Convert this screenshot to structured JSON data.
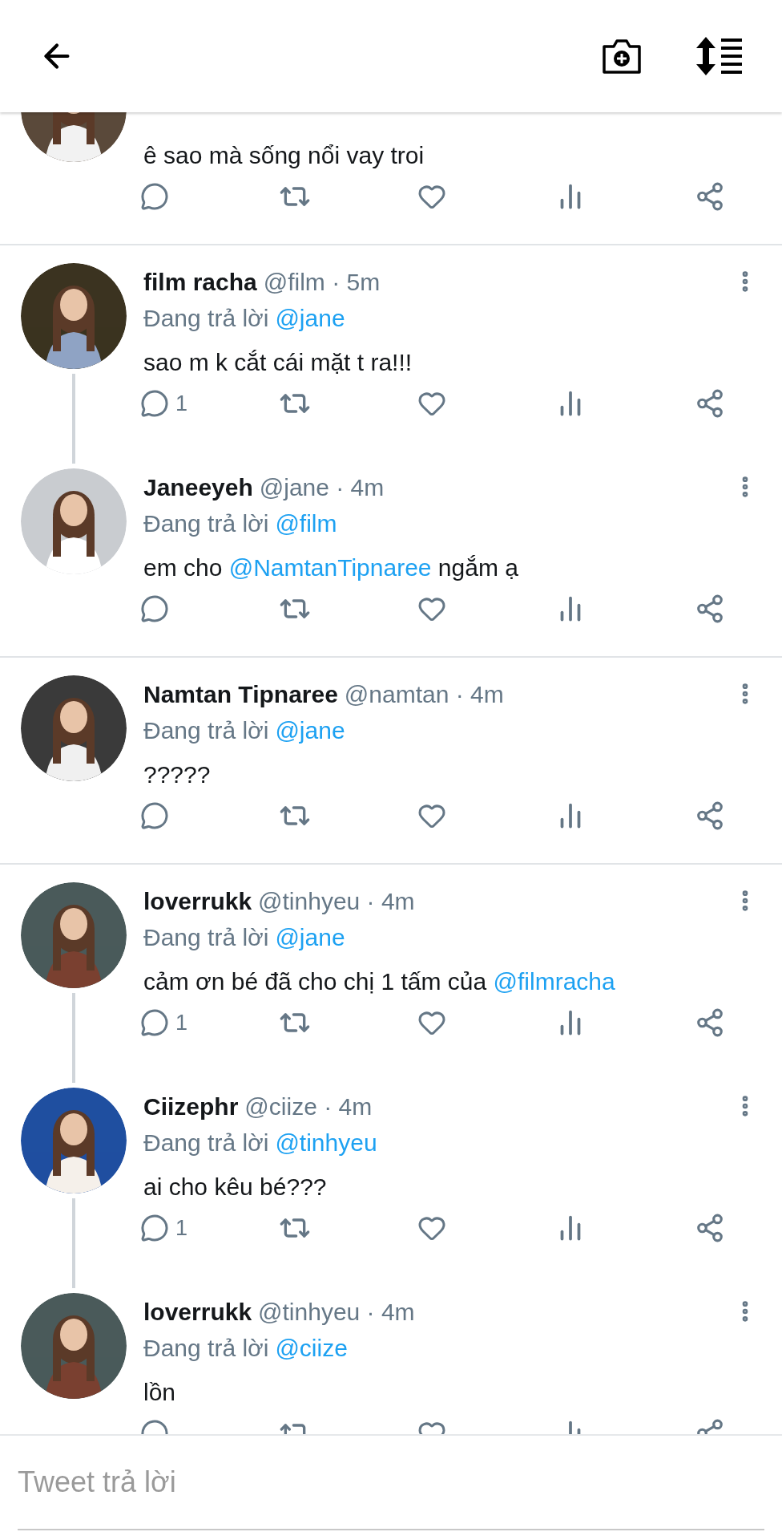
{
  "threads": [
    {
      "tweets": [
        {
          "text": [
            {
              "kind": "plain",
              "text": "ê sao mà sống nổi vay troi"
            }
          ],
          "avatar": {
            "kind": "picture"
          }
        }
      ]
    },
    {
      "tweets": [
        {
          "name": "film racha",
          "meta": "@film · 5m",
          "reply_label": "Đang trả lời",
          "reply_to": "@jane",
          "text": [
            {
              "kind": "plain",
              "text": "sao m k cắt cái mặt t ra!!!"
            }
          ],
          "reply_count": "1",
          "avatar": {
            "kind": "picture"
          }
        },
        {
          "name": "Janeeyeh",
          "meta": "@jane · 4m",
          "reply_label": "Đang trả lời",
          "reply_to": "@film",
          "text": [
            {
              "kind": "plain",
              "text": "em cho "
            },
            {
              "kind": "mention",
              "text": "@NamtanTipnaree"
            },
            {
              "kind": "plain",
              "text": " ngắm ạ"
            }
          ],
          "avatar": {
            "kind": "picture"
          }
        }
      ]
    },
    {
      "tweets": [
        {
          "name": "Namtan Tipnaree",
          "meta": "@namtan · 4m",
          "reply_label": "Đang trả lời",
          "reply_to": "@jane",
          "text": [
            {
              "kind": "plain",
              "text": "?????"
            }
          ],
          "avatar": {
            "kind": "picture"
          }
        }
      ]
    },
    {
      "tweets": [
        {
          "name": "loverrukk",
          "meta": "@tinhyeu · 4m",
          "reply_label": "Đang trả lời",
          "reply_to": "@jane",
          "text": [
            {
              "kind": "plain",
              "text": "cảm ơn bé đã cho chị 1 tấm của "
            },
            {
              "kind": "mention",
              "text": "@filmracha"
            }
          ],
          "reply_count": "1",
          "avatar": {
            "kind": "picture"
          }
        },
        {
          "name": "Ciizephr",
          "meta": "@ciize · 4m",
          "reply_label": "Đang trả lời",
          "reply_to": "@tinhyeu",
          "text": [
            {
              "kind": "plain",
              "text": "ai cho kêu bé???"
            }
          ],
          "reply_count": "1",
          "avatar": {
            "kind": "picture"
          }
        },
        {
          "name": "loverrukk",
          "meta": "@tinhyeu · 4m",
          "reply_label": "Đang trả lời",
          "reply_to": "@ciize",
          "text": [
            {
              "kind": "plain",
              "text": "lồn"
            }
          ],
          "avatar": {
            "kind": "picture"
          }
        }
      ]
    }
  ],
  "reply_bar": {
    "placeholder": "Tweet trả lời"
  }
}
